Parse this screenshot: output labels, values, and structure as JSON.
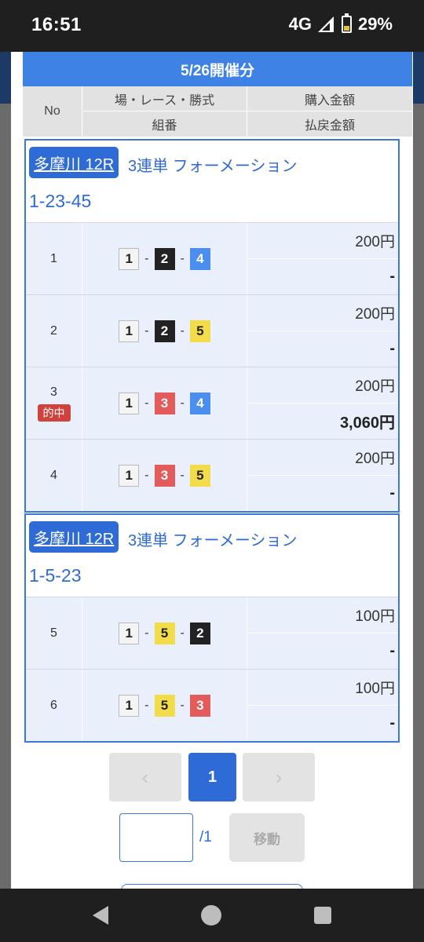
{
  "status": {
    "time": "16:51",
    "network": "4G",
    "battery": "29%"
  },
  "title": "5/26開催分",
  "header": {
    "no": "No",
    "race": "場・レース・勝式",
    "amount": "購入金額",
    "combo": "組番",
    "refund": "払戻金額"
  },
  "groups": [
    {
      "venue": "多摩川 12R",
      "bet_type": "3連単 フォーメーション",
      "formation": "1-23-45",
      "rows": [
        {
          "no": "1",
          "n1": "1",
          "n2": "2",
          "n3": "4",
          "amount": "200円",
          "refund": "-",
          "hit": ""
        },
        {
          "no": "2",
          "n1": "1",
          "n2": "2",
          "n3": "5",
          "amount": "200円",
          "refund": "-",
          "hit": ""
        },
        {
          "no": "3",
          "n1": "1",
          "n2": "3",
          "n3": "4",
          "amount": "200円",
          "refund": "3,060円",
          "hit": "的中"
        },
        {
          "no": "4",
          "n1": "1",
          "n2": "3",
          "n3": "5",
          "amount": "200円",
          "refund": "-",
          "hit": ""
        }
      ]
    },
    {
      "venue": "多摩川 12R",
      "bet_type": "3連単 フォーメーション",
      "formation": "1-5-23",
      "rows": [
        {
          "no": "5",
          "n1": "1",
          "n2": "5",
          "n3": "2",
          "amount": "100円",
          "refund": "-",
          "hit": ""
        },
        {
          "no": "6",
          "n1": "1",
          "n2": "5",
          "n3": "3",
          "amount": "100円",
          "refund": "-",
          "hit": ""
        }
      ]
    }
  ],
  "pagination": {
    "prev_icon": "‹",
    "current": "1",
    "next_icon": "›",
    "total": "/1",
    "move_label": "移動"
  },
  "colors": {
    "accent": "#2f6bd6",
    "title_bar": "#3d82e4",
    "hit": "#d0433c"
  }
}
